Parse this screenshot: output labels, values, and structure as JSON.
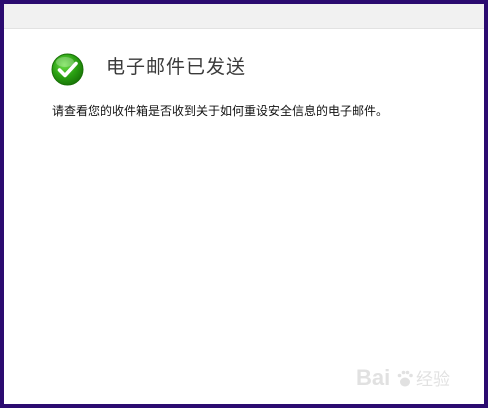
{
  "dialog": {
    "title": "电子邮件已发送",
    "message": "请查看您的收件箱是否收到关于如何重设安全信息的电子邮件。"
  },
  "icons": {
    "status": "green-check-icon"
  },
  "watermark": {
    "brand": "Bai",
    "icon": "baidu-paw-icon",
    "text": "经验"
  },
  "colors": {
    "frame": "#2b0b70",
    "check_green": "#2aa012",
    "topbar": "#f1f1f1"
  }
}
